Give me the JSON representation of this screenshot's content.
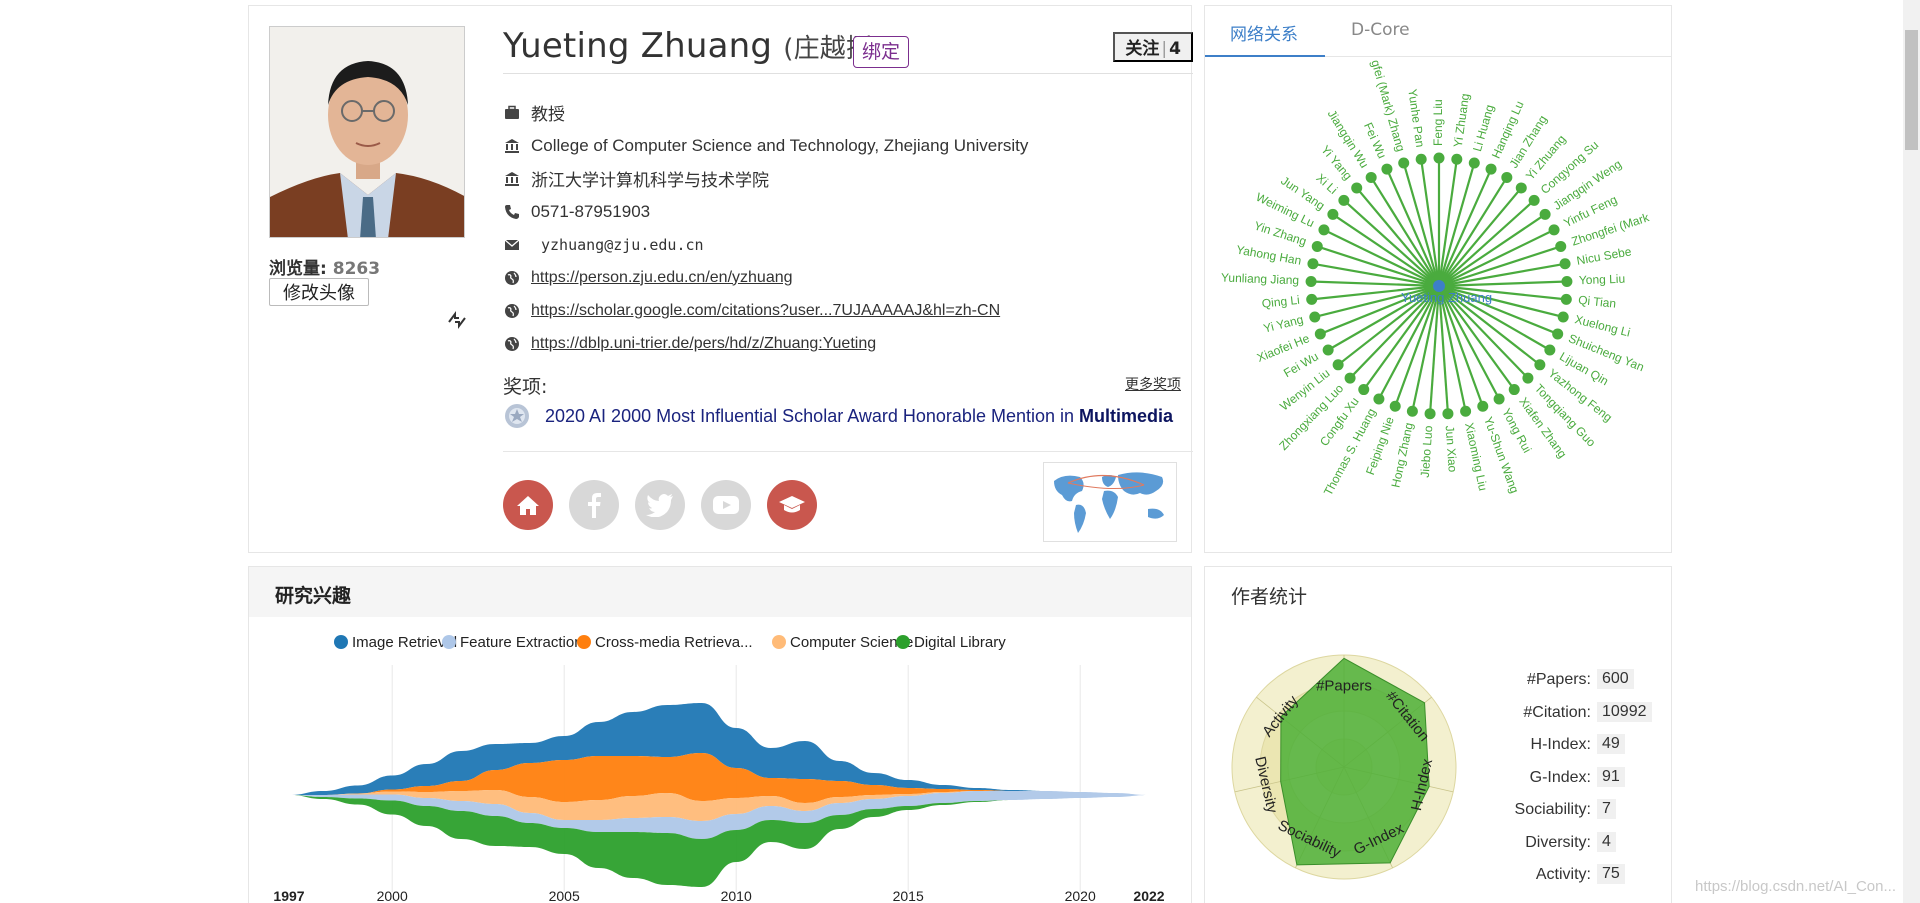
{
  "profile": {
    "name": "Yueting Zhuang",
    "name_cn": "(庄越挺)",
    "bind_label": "绑定",
    "follow_label": "关注",
    "follow_count": "4",
    "views_label": "浏览量:",
    "views_count": "8263",
    "change_avatar_label": "修改头像",
    "title": "教授",
    "affiliation_en": "College of Computer Science and Technology, Zhejiang University",
    "affiliation_cn": "浙江大学计算机科学与技术学院",
    "phone": "0571-87951903",
    "email": "yzhuang@zju.edu.cn",
    "homepage": "https://person.zju.edu.cn/en/yzhuang",
    "scholar": "https://scholar.google.com/citations?user...7UJAAAAAJ&hl=zh-CN",
    "dblp": "https://dblp.uni-trier.de/pers/hd/z/Zhuang:Yueting",
    "awards_label": "奖项:",
    "more_awards_label": "更多奖项",
    "award_text": "2020 AI 2000 Most Influential Scholar Award Honorable Mention in",
    "award_field": "Multimedia"
  },
  "social": {
    "home": "home-icon",
    "facebook": "facebook-icon",
    "twitter": "twitter-icon",
    "youtube": "youtube-icon",
    "scholar": "graduation-cap-icon"
  },
  "network": {
    "tabs": [
      "网络关系",
      "D-Core"
    ],
    "center": "Yueting Zhuang",
    "nodes": [
      "Feng Liu",
      "Yi Zhuang",
      "Li Huang",
      "Hanqing Lu",
      "Jian Zhang",
      "Yi Zhuang",
      "Congyong Su",
      "Jiangqin Weng",
      "Yinfu Feng",
      "Zhongfei (Mark",
      "Nicu Sebe",
      "Yong Liu",
      "Qi Tian",
      "Xuelong Li",
      "Shuicheng Yan",
      "Lijuan Qin",
      "Yazhong Feng",
      "Tongqiang Guo",
      "Xiafen Zhang",
      "Yong Rui",
      "Yu-Shun Wang",
      "Xiaoming Liu",
      "Jun Xiao",
      "Jiebo Luo",
      "Hong Zhang",
      "Feiping Nie",
      "Thomas S. Huang",
      "Congfu Xu",
      "Zhongxiang Luo",
      "Wenyin Liu",
      "Fei Wu",
      "Xiaofei He",
      "Yi Yang",
      "Qing Li",
      "Yunliang Jiang",
      "Yahong Han",
      "Yin Zhang",
      "Weiming Lu",
      "Jun Yang",
      "Xi Li",
      "Yi Yang",
      "Jiangqin Wu",
      "Fei Wu",
      "gfei (Mark) Zhang",
      "Yunhe Pan"
    ],
    "color": "#4aab3e"
  },
  "interests": {
    "title": "研究兴趣",
    "legend": [
      {
        "name": "Image Retrieval",
        "color": "#1f77b4"
      },
      {
        "name": "Feature Extraction",
        "color": "#aec7e8"
      },
      {
        "name": "Cross-media Retrieva...",
        "color": "#ff7f0e"
      },
      {
        "name": "Computer Science",
        "color": "#ffbb78"
      },
      {
        "name": "Digital Library",
        "color": "#2ca02c"
      }
    ],
    "years": [
      "1997",
      "2000",
      "2005",
      "2010",
      "2015",
      "2020",
      "2022"
    ]
  },
  "stats": {
    "title": "作者统计",
    "items": [
      {
        "label": "#Papers:",
        "value": "600"
      },
      {
        "label": "#Citation:",
        "value": "10992"
      },
      {
        "label": "H-Index:",
        "value": "49"
      },
      {
        "label": "G-Index:",
        "value": "91"
      },
      {
        "label": "Sociability:",
        "value": "7"
      },
      {
        "label": "Diversity:",
        "value": "4"
      },
      {
        "label": "Activity:",
        "value": "75"
      }
    ],
    "radar_axes": [
      "#Papers",
      "#Citation",
      "H-Index",
      "G-Index",
      "Sociability",
      "Diversity",
      "Activity"
    ]
  },
  "watermark": "https://blog.csdn.net/AI_Con..."
}
